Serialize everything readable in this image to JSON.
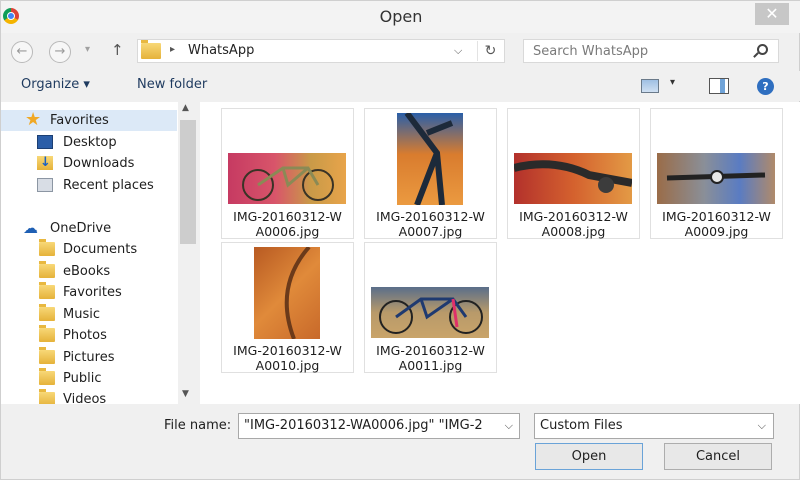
{
  "window": {
    "title": "Open",
    "close_glyph": "✕"
  },
  "nav_buttons": {
    "back": "←",
    "forward": "→",
    "recent": "▾",
    "up": "↑"
  },
  "address": {
    "separator": "▸",
    "path": "WhatsApp",
    "dropdown": "⌵",
    "refresh": "↻"
  },
  "search": {
    "placeholder": "Search WhatsApp"
  },
  "toolbar": {
    "organize": "Organize ▾",
    "new_folder": "New folder",
    "view_dropdown": "▾",
    "help": "?"
  },
  "sidebar": {
    "favorites_label": "Favorites",
    "favorites": [
      {
        "label": "Desktop",
        "icon": "desktop-icon"
      },
      {
        "label": "Downloads",
        "icon": "downloads-icon"
      },
      {
        "label": "Recent places",
        "icon": "recent-places-icon"
      }
    ],
    "onedrive_label": "OneDrive",
    "onedrive": [
      {
        "label": "Documents",
        "icon": "folder-icon"
      },
      {
        "label": "eBooks",
        "icon": "folder-icon"
      },
      {
        "label": "Favorites",
        "icon": "folder-icon"
      },
      {
        "label": "Music",
        "icon": "folder-icon"
      },
      {
        "label": "Photos",
        "icon": "folder-icon"
      },
      {
        "label": "Pictures",
        "icon": "folder-icon"
      },
      {
        "label": "Public",
        "icon": "folder-icon"
      },
      {
        "label": "Videos",
        "icon": "folder-icon"
      }
    ],
    "scroll_up": "▲",
    "scroll_down": "▼"
  },
  "files": [
    {
      "name": "IMG-20160312-W\nA0006.jpg"
    },
    {
      "name": "IMG-20160312-W\nA0007.jpg"
    },
    {
      "name": "IMG-20160312-W\nA0008.jpg"
    },
    {
      "name": "IMG-20160312-W\nA0009.jpg"
    },
    {
      "name": "IMG-20160312-W\nA0010.jpg"
    },
    {
      "name": "IMG-20160312-W\nA0011.jpg"
    }
  ],
  "bottom": {
    "file_name_label": "File name:",
    "file_name_value": "\"IMG-20160312-WA0006.jpg\" \"IMG-2",
    "file_type": "Custom Files",
    "dropdown": "⌵",
    "open_label": "Open",
    "cancel_label": "Cancel"
  },
  "colors": {
    "selection": "#dce9f7",
    "link": "#1e3a5f",
    "accent": "#2f6fc0"
  }
}
